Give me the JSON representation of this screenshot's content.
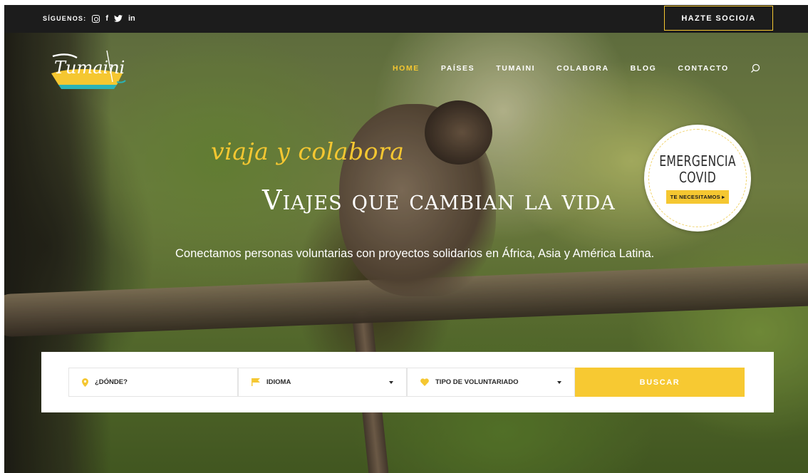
{
  "topbar": {
    "follow_label": "SÍGUENOS:",
    "social_icons": [
      "instagram-icon",
      "facebook-icon",
      "twitter-icon",
      "linkedin-icon"
    ],
    "facebook_glyph": "f",
    "linkedin_glyph": "in",
    "socio_button": "HAZTE SOCIO/A"
  },
  "logo": {
    "text": "Tumaini"
  },
  "nav": {
    "items": [
      {
        "label": "HOME",
        "active": true
      },
      {
        "label": "PAÍSES",
        "active": false
      },
      {
        "label": "TUMAINI",
        "active": false
      },
      {
        "label": "COLABORA",
        "active": false
      },
      {
        "label": "BLOG",
        "active": false
      },
      {
        "label": "CONTACTO",
        "active": false
      }
    ],
    "search_icon": "search-icon"
  },
  "hero": {
    "tagline": "viaja y colabora",
    "headline": "Viajes que cambian la vida",
    "subline": "Conectamos personas voluntarias con proyectos solidarios en África, Asia y América Latina."
  },
  "covid_badge": {
    "line1": "EMERGENCIA",
    "line2": "COVID",
    "cta": "TE NECESITAMOS ▸"
  },
  "search": {
    "where_label": "¿DÓNDE?",
    "language_label": "IDIOMA",
    "type_label": "TIPO DE VOLUNTARIADO",
    "button_label": "BUSCAR"
  },
  "colors": {
    "accent": "#f5c731",
    "topbar_bg": "#1c1c1c",
    "text_dark": "#2a2a2a"
  }
}
